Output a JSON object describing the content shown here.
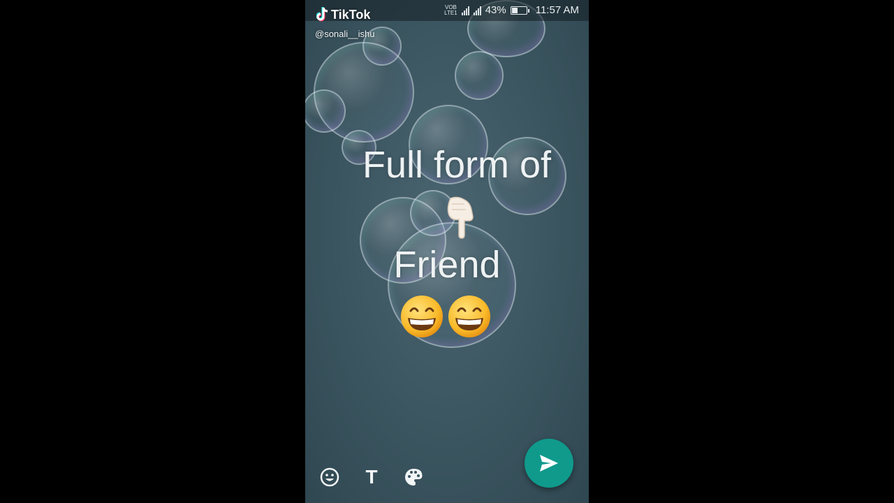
{
  "status_bar": {
    "carrier_tag": "VoLTE",
    "volte_top": "VOB",
    "volte_bottom": "LTE1",
    "battery": "43%",
    "battery_level": 0.43,
    "time": "11:57 AM"
  },
  "watermark": {
    "brand": "TikTok",
    "handle": "@sonali__ishu"
  },
  "content": {
    "line1": "Full form of",
    "pointer_emoji": "pointing-down-hand",
    "line2": "Friend",
    "emojis": [
      "grinning-face",
      "grinning-face"
    ]
  },
  "toolbar": {
    "emoji_icon": "smiley-icon",
    "text_tool": "T",
    "palette_icon": "palette-icon"
  },
  "colors": {
    "background": "#3b5560",
    "send_button": "#0f9a8c",
    "text": "#eef2f3"
  }
}
